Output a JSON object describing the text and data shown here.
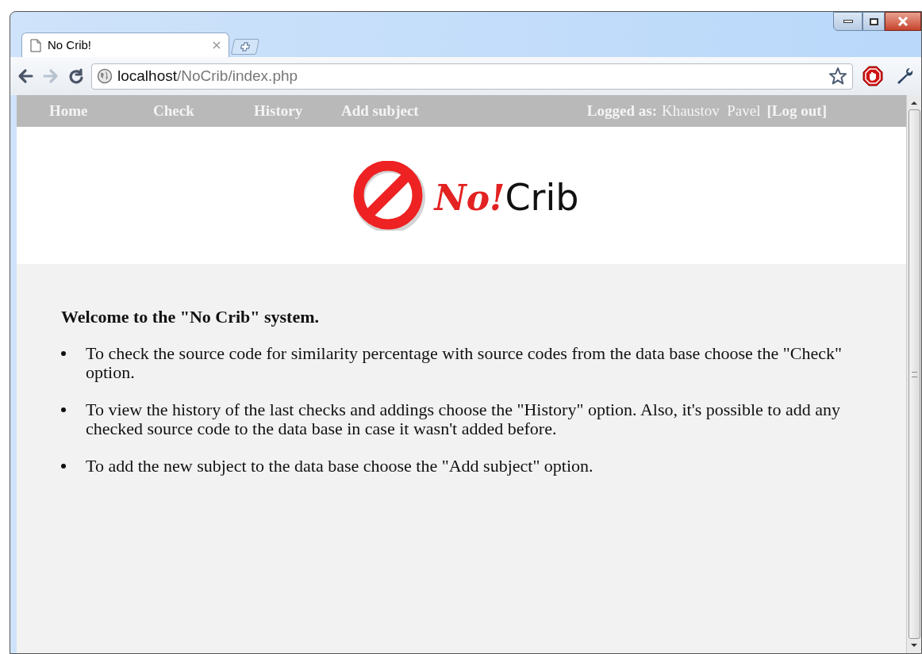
{
  "window": {
    "tabs": [
      {
        "title": "No Crib!",
        "selected": true
      }
    ],
    "url": {
      "host": "localhost",
      "path": "/NoCrib/index.php"
    },
    "nav_buttons": [
      {
        "kind": "back",
        "disabled": false
      },
      {
        "kind": "forward",
        "disabled": true
      },
      {
        "kind": "reload",
        "disabled": false
      }
    ]
  },
  "menu": {
    "items": [
      "Home",
      "Check",
      "History",
      "Add subject"
    ],
    "user_label": "Logged as:",
    "user_name": "Khaustov  Pavel",
    "logout": "[Log out]"
  },
  "logo": {
    "accent": "No!",
    "name": "Crib"
  },
  "content": {
    "heading": "Welcome to the \"No Crib\" system.",
    "bullets": [
      "To check the source code for similarity percentage with source codes from the data base choose the \"Check\" option.",
      "To view the history of the last checks and addings choose the \"History\" option. Also, it's possible to add any checked source code to the data base in case it wasn't added before.",
      "To add the new subject to the data base choose the \"Add subject\" option."
    ]
  }
}
